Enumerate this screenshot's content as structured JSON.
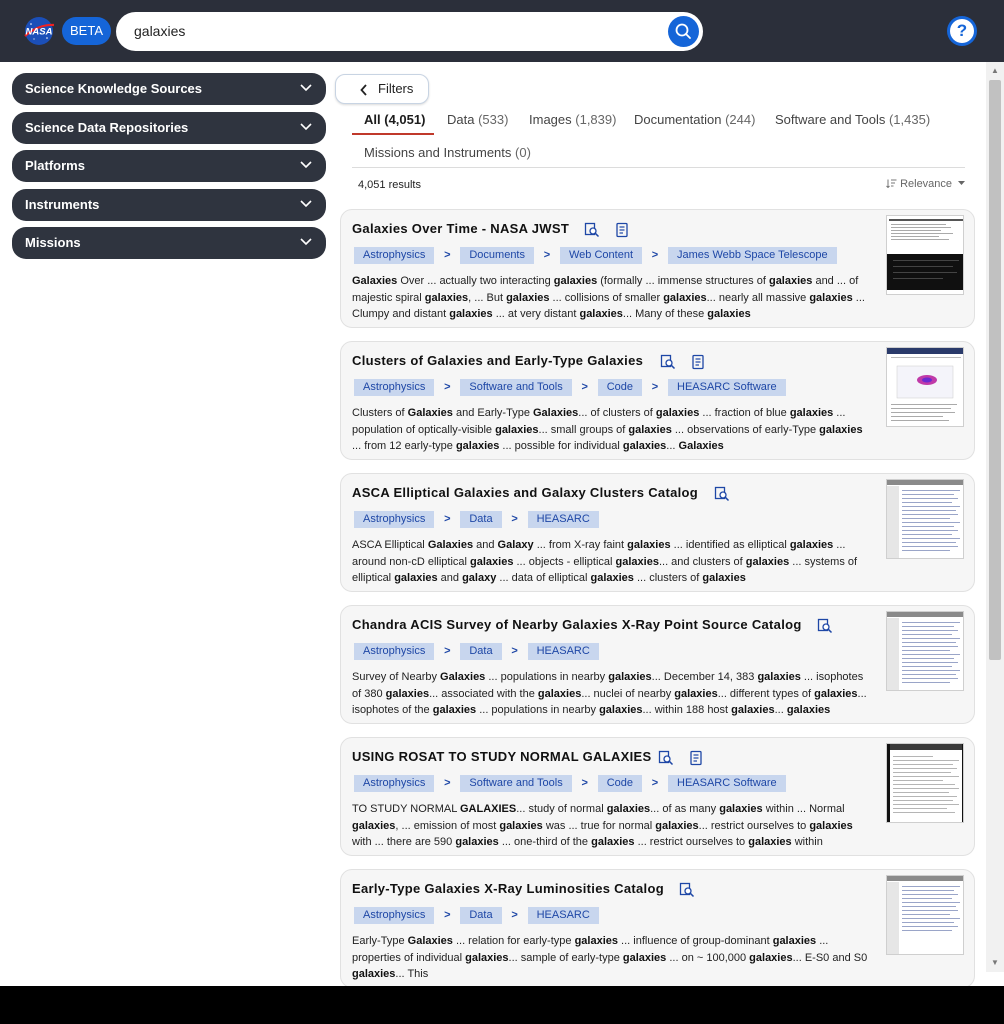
{
  "header": {
    "logo_text": "NASA",
    "beta_label": "BETA",
    "search_value": "galaxies",
    "help_label": "?"
  },
  "sidebar": {
    "items": [
      {
        "label": "Science Knowledge Sources"
      },
      {
        "label": "Science Data Repositories"
      },
      {
        "label": "Platforms"
      },
      {
        "label": "Instruments"
      },
      {
        "label": "Missions"
      }
    ]
  },
  "filters_label": "Filters",
  "tabs": [
    {
      "label": "All",
      "count": "(4,051)"
    },
    {
      "label": "Data",
      "count": "(533)"
    },
    {
      "label": "Images",
      "count": "(1,839)"
    },
    {
      "label": "Documentation",
      "count": "(244)"
    },
    {
      "label": "Software and Tools",
      "count": "(1,435)"
    },
    {
      "label": "Missions and Instruments",
      "count": "(0)"
    }
  ],
  "results_count": "4,051 results",
  "sort_label": "Relevance",
  "breadcrumb_separator": ">",
  "results": [
    {
      "title": "Galaxies Over Time - NASA JWST",
      "crumbs": [
        "Astrophysics",
        "Documents",
        "Web Content",
        "James Webb Space Telescope"
      ],
      "snippet": "<b>Galaxies</b> Over ... actually two interacting <b>galaxies</b> (formally ... immense structures of <b>galaxies</b> and ... of majestic spiral <b>galaxies</b>, ... But <b>galaxies</b> ... collisions of smaller <b>galaxies</b>... nearly all massive <b>galaxies</b> ... Clumpy and distant <b>galaxies</b> ... at very distant <b>galaxies</b>... Many of these <b>galaxies</b>"
    },
    {
      "title": "Clusters of Galaxies and Early-Type Galaxies",
      "crumbs": [
        "Astrophysics",
        "Software and Tools",
        "Code",
        "HEASARC Software"
      ],
      "snippet": "Clusters of <b>Galaxies</b> and Early-Type <b>Galaxies</b>... of clusters of <b>galaxies</b> ... fraction of blue <b>galaxies</b> ... population of optically-visible <b>galaxies</b>... small groups of <b>galaxies</b> ... observations of early-Type <b>galaxies</b> ... from 12 early-type <b>galaxies</b> ... possible for individual <b>galaxies</b>... <b>Galaxies</b>"
    },
    {
      "title": "ASCA Elliptical Galaxies and Galaxy Clusters Catalog",
      "crumbs": [
        "Astrophysics",
        "Data",
        "HEASARC"
      ],
      "snippet": "ASCA Elliptical <b>Galaxies</b> and <b>Galaxy</b> ... from X-ray faint <b>galaxies</b> ... identified as elliptical <b>galaxies</b> ... around non-cD elliptical <b>galaxies</b> ... objects - elliptical <b>galaxies</b>... and clusters of <b>galaxies</b> ... systems of elliptical <b>galaxies</b> and <b>galaxy</b> ... data of elliptical <b>galaxies</b> ... clusters of <b>galaxies</b>"
    },
    {
      "title": "Chandra ACIS Survey of Nearby Galaxies X-Ray Point Source Catalog",
      "crumbs": [
        "Astrophysics",
        "Data",
        "HEASARC"
      ],
      "snippet": "Survey of Nearby <b>Galaxies</b> ... populations in nearby <b>galaxies</b>... December 14, 383 <b>galaxies</b> ... isophotes of 380 <b>galaxies</b>... associated with the <b>galaxies</b>... nuclei of nearby <b>galaxies</b>... different types of <b>galaxies</b>... isophotes of the <b>galaxies</b> ... populations in nearby <b>galaxies</b>... within 188 host <b>galaxies</b>... <b>galaxies</b>"
    },
    {
      "title": "USING ROSAT TO STUDY NORMAL GALAXIES",
      "crumbs": [
        "Astrophysics",
        "Software and Tools",
        "Code",
        "HEASARC Software"
      ],
      "snippet": "TO STUDY NORMAL <b>GALAXIES</b>... study of normal <b>galaxies</b>... of as many <b>galaxies</b> within ... Normal <b>galaxies</b>, ... emission of most <b>galaxies</b> was ... true for normal <b>galaxies</b>... restrict ourselves to <b>galaxies</b> with ... there are 590 <b>galaxies</b> ... one-third of the <b>galaxies</b> ... restrict ourselves to <b>galaxies</b> within"
    },
    {
      "title": "Early-Type Galaxies X-Ray Luminosities Catalog",
      "crumbs": [
        "Astrophysics",
        "Data",
        "HEASARC"
      ],
      "snippet": "Early-Type <b>Galaxies</b> ... relation for early-type <b>galaxies</b> ... influence of group-dominant <b>galaxies</b> ... properties of individual <b>galaxies</b>... sample of early-type <b>galaxies</b> ... on ~ 100,000 <b>galaxies</b>... E-S0 and S0 <b>galaxies</b>... This"
    }
  ]
}
